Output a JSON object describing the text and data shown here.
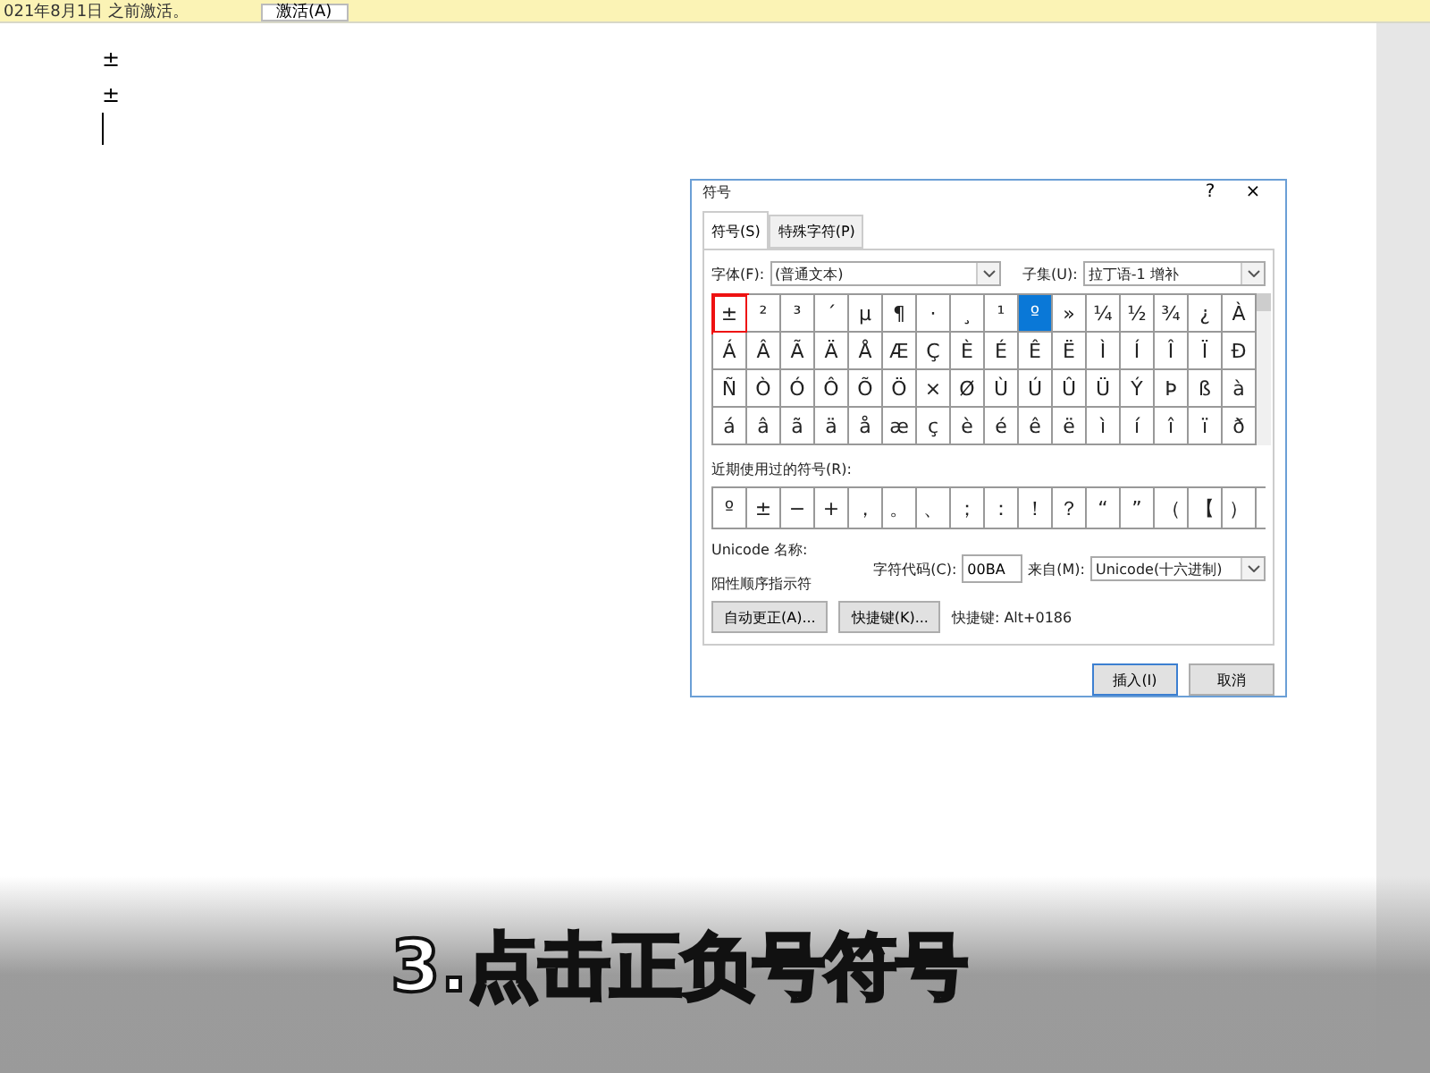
{
  "notice_bar": {
    "text": "021年8月1日 之前激活。",
    "button": "激活(A)"
  },
  "document": {
    "lines": [
      "±",
      "±"
    ]
  },
  "dialog": {
    "title": "符号",
    "help": "?",
    "close": "×",
    "tabs": [
      {
        "label": "符号(S)",
        "selected": true
      },
      {
        "label": "特殊字符(P)",
        "selected": false
      }
    ],
    "font": {
      "label": "字体(F):",
      "value": "(普通文本)"
    },
    "subset": {
      "label": "子集(U):",
      "value": "拉丁语-1 增补"
    },
    "grid": [
      [
        {
          "char": "±",
          "selected": false,
          "marked": true
        },
        {
          "char": "²",
          "selected": false,
          "marked": false
        },
        {
          "char": "³",
          "selected": false,
          "marked": false
        },
        {
          "char": "´",
          "selected": false,
          "marked": false
        },
        {
          "char": "µ",
          "selected": false,
          "marked": false
        },
        {
          "char": "¶",
          "selected": false,
          "marked": false
        },
        {
          "char": "·",
          "selected": false,
          "marked": false
        },
        {
          "char": "¸",
          "selected": false,
          "marked": false
        },
        {
          "char": "¹",
          "selected": false,
          "marked": false
        },
        {
          "char": "º",
          "selected": true,
          "marked": false
        },
        {
          "char": "»",
          "selected": false,
          "marked": false
        },
        {
          "char": "¼",
          "selected": false,
          "marked": false
        },
        {
          "char": "½",
          "selected": false,
          "marked": false
        },
        {
          "char": "¾",
          "selected": false,
          "marked": false
        },
        {
          "char": "¿",
          "selected": false,
          "marked": false
        },
        {
          "char": "À",
          "selected": false,
          "marked": false
        }
      ],
      [
        {
          "char": "Á",
          "selected": false,
          "marked": false
        },
        {
          "char": "Â",
          "selected": false,
          "marked": false
        },
        {
          "char": "Ã",
          "selected": false,
          "marked": false
        },
        {
          "char": "Ä",
          "selected": false,
          "marked": false
        },
        {
          "char": "Å",
          "selected": false,
          "marked": false
        },
        {
          "char": "Æ",
          "selected": false,
          "marked": false
        },
        {
          "char": "Ç",
          "selected": false,
          "marked": false
        },
        {
          "char": "È",
          "selected": false,
          "marked": false
        },
        {
          "char": "É",
          "selected": false,
          "marked": false
        },
        {
          "char": "Ê",
          "selected": false,
          "marked": false
        },
        {
          "char": "Ë",
          "selected": false,
          "marked": false
        },
        {
          "char": "Ì",
          "selected": false,
          "marked": false
        },
        {
          "char": "Í",
          "selected": false,
          "marked": false
        },
        {
          "char": "Î",
          "selected": false,
          "marked": false
        },
        {
          "char": "Ï",
          "selected": false,
          "marked": false
        },
        {
          "char": "Ð",
          "selected": false,
          "marked": false
        }
      ],
      [
        {
          "char": "Ñ",
          "selected": false,
          "marked": false
        },
        {
          "char": "Ò",
          "selected": false,
          "marked": false
        },
        {
          "char": "Ó",
          "selected": false,
          "marked": false
        },
        {
          "char": "Ô",
          "selected": false,
          "marked": false
        },
        {
          "char": "Õ",
          "selected": false,
          "marked": false
        },
        {
          "char": "Ö",
          "selected": false,
          "marked": false
        },
        {
          "char": "×",
          "selected": false,
          "marked": false
        },
        {
          "char": "Ø",
          "selected": false,
          "marked": false
        },
        {
          "char": "Ù",
          "selected": false,
          "marked": false
        },
        {
          "char": "Ú",
          "selected": false,
          "marked": false
        },
        {
          "char": "Û",
          "selected": false,
          "marked": false
        },
        {
          "char": "Ü",
          "selected": false,
          "marked": false
        },
        {
          "char": "Ý",
          "selected": false,
          "marked": false
        },
        {
          "char": "Þ",
          "selected": false,
          "marked": false
        },
        {
          "char": "ß",
          "selected": false,
          "marked": false
        },
        {
          "char": "à",
          "selected": false,
          "marked": false
        }
      ],
      [
        {
          "char": "á",
          "selected": false,
          "marked": false
        },
        {
          "char": "â",
          "selected": false,
          "marked": false
        },
        {
          "char": "ã",
          "selected": false,
          "marked": false
        },
        {
          "char": "ä",
          "selected": false,
          "marked": false
        },
        {
          "char": "å",
          "selected": false,
          "marked": false
        },
        {
          "char": "æ",
          "selected": false,
          "marked": false
        },
        {
          "char": "ç",
          "selected": false,
          "marked": false
        },
        {
          "char": "è",
          "selected": false,
          "marked": false
        },
        {
          "char": "é",
          "selected": false,
          "marked": false
        },
        {
          "char": "ê",
          "selected": false,
          "marked": false
        },
        {
          "char": "ë",
          "selected": false,
          "marked": false
        },
        {
          "char": "ì",
          "selected": false,
          "marked": false
        },
        {
          "char": "í",
          "selected": false,
          "marked": false
        },
        {
          "char": "î",
          "selected": false,
          "marked": false
        },
        {
          "char": "ï",
          "selected": false,
          "marked": false
        },
        {
          "char": "ð",
          "selected": false,
          "marked": false
        }
      ]
    ],
    "recent_label": "近期使用过的符号(R):",
    "recent": [
      "º",
      "±",
      "−",
      "+",
      "，",
      "。",
      "、",
      "；",
      "：",
      "！",
      "？",
      "“",
      "”",
      "（",
      "【",
      "）"
    ],
    "unicode_label": "Unicode 名称:",
    "unicode_name": "阳性顺序指示符",
    "code": {
      "label": "字符代码(C):",
      "value": "00BA"
    },
    "from": {
      "label": "来自(M):",
      "value": "Unicode(十六进制)"
    },
    "autocorrect": "自动更正(A)...",
    "shortcut_button": "快捷键(K)...",
    "shortcut_text": "快捷键: Alt+0186",
    "insert": "插入(I)",
    "cancel": "取消"
  },
  "caption": "3.点击正负号符号"
}
